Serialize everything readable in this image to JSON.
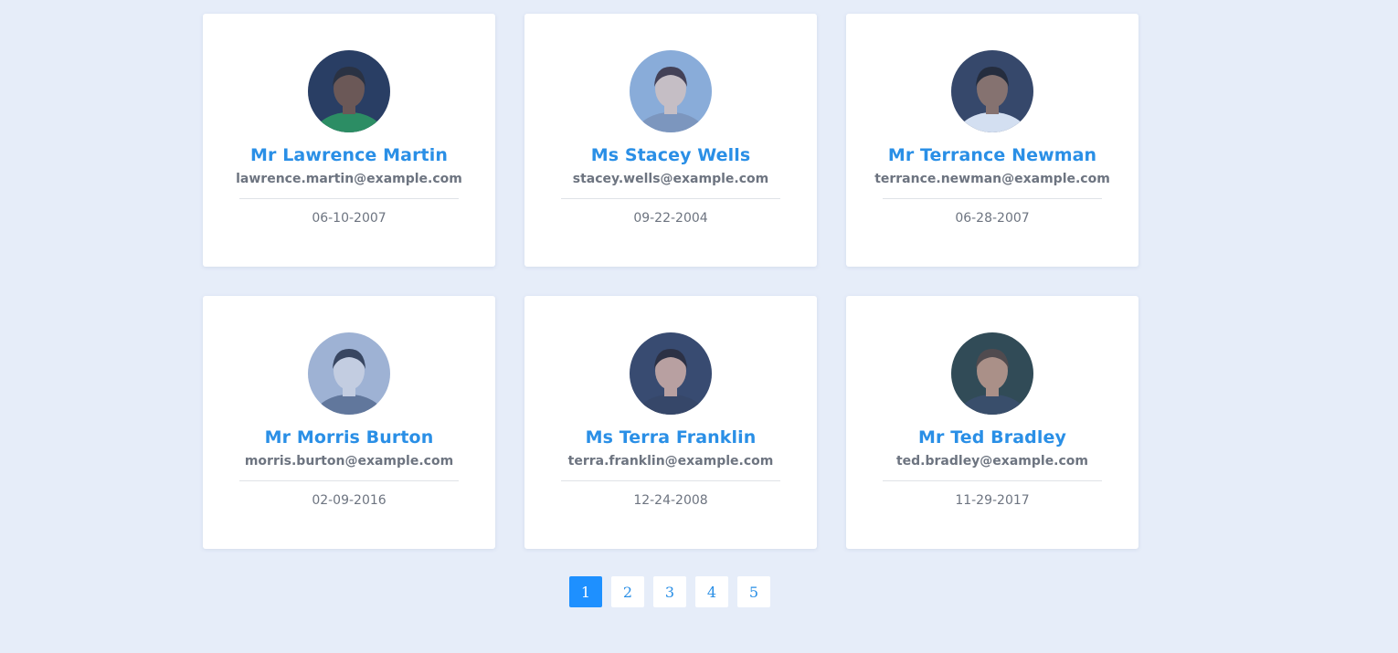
{
  "people": [
    {
      "name": "Mr Lawrence Martin",
      "email": "lawrence.martin@example.com",
      "date": "06-10-2007",
      "avatar": {
        "bg": "#1a2a4a",
        "skin": "#6b4a3a",
        "hair": "#1b1b22",
        "shirt": "#1e8a4a"
      }
    },
    {
      "name": "Ms Stacey Wells",
      "email": "stacey.wells@example.com",
      "date": "09-22-2004",
      "avatar": {
        "bg": "#8fb0d8",
        "skin": "#d8c6c0",
        "hair": "#3a2e3a",
        "shirt": "#7f95b8"
      }
    },
    {
      "name": "Mr Terrance Newman",
      "email": "terrance.newman@example.com",
      "date": "06-28-2007",
      "avatar": {
        "bg": "#2a3652",
        "skin": "#8a6a58",
        "hair": "#15151c",
        "shirt": "#e9eef6"
      }
    },
    {
      "name": "Mr Morris Burton",
      "email": "morris.burton@example.com",
      "date": "02-09-2016",
      "avatar": {
        "bg": "#a9b8d2",
        "skin": "#d6d8e2",
        "hair": "#2c3446",
        "shirt": "#5f6f8e"
      }
    },
    {
      "name": "Ms Terra Franklin",
      "email": "terra.franklin@example.com",
      "date": "12-24-2008",
      "avatar": {
        "bg": "#2c3a5a",
        "skin": "#c9a294",
        "hair": "#1e1a24",
        "shirt": "#2a3550"
      }
    },
    {
      "name": "Mr Ted Bradley",
      "email": "ted.bradley@example.com",
      "date": "11-29-2017",
      "avatar": {
        "bg": "#243a3a",
        "skin": "#b88e76",
        "hair": "#4a3a30",
        "shirt": "#2e3d52"
      }
    }
  ],
  "pagination": {
    "pages": [
      "1",
      "2",
      "3",
      "4",
      "5"
    ],
    "current": "1"
  },
  "colors": {
    "background": "#e6edf9",
    "accent": "#1e90ff",
    "name": "#2a8fe6",
    "muted": "#6d7480"
  }
}
